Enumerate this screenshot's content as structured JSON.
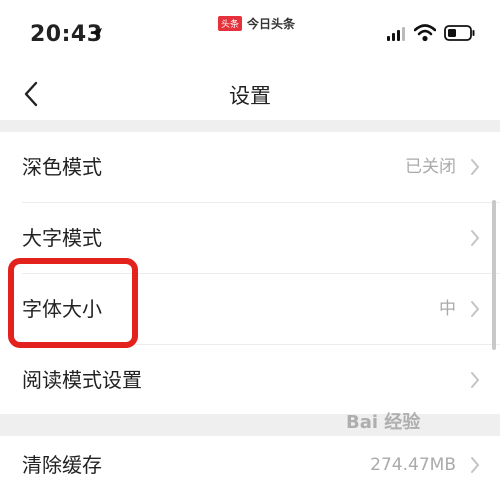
{
  "status_bar": {
    "time": "20:43",
    "brand_badge": "头条",
    "brand_name": "今日头条"
  },
  "nav": {
    "title": "设置"
  },
  "settings": {
    "items": [
      {
        "label": "深色模式",
        "value": "已关闭"
      },
      {
        "label": "大字模式",
        "value": ""
      },
      {
        "label": "字体大小",
        "value": "中"
      },
      {
        "label": "阅读模式设置",
        "value": ""
      }
    ],
    "cache": {
      "label": "清除缓存",
      "value": "274.47MB"
    }
  },
  "watermark": "Bai 经验",
  "colors": {
    "highlight": "#e3221e",
    "brand": "#e4313b",
    "section_gap": "#efefef"
  }
}
